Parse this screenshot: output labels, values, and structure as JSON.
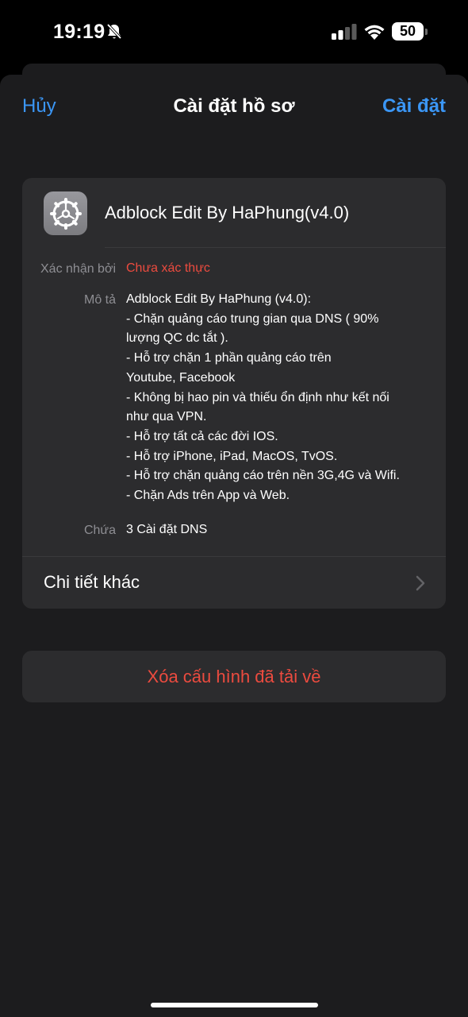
{
  "status_bar": {
    "time": "19:19",
    "battery": "50",
    "icons": [
      "bell-slash-icon",
      "cellular-signal-icon",
      "wifi-icon",
      "battery-icon"
    ]
  },
  "nav": {
    "cancel": "Hủy",
    "title": "Cài đặt hồ sơ",
    "install": "Cài đặt"
  },
  "profile": {
    "icon": "settings-gear-icon",
    "name": "Adblock Edit By HaPhung(v4.0)",
    "verified_by_label": "Xác nhận bởi",
    "verified_by_value": "Chưa xác thực",
    "description_label": "Mô tả",
    "description_lines": [
      "Adblock Edit By HaPhung (v4.0):",
      "- Chặn quảng cáo trung gian qua DNS ( 90%",
      "lượng QC dc tắt ).",
      "- Hỗ trợ chặn 1 phần quảng cáo trên",
      "Youtube, Facebook",
      "- Không bị hao pin và thiếu ổn định như kết nối",
      "như qua VPN.",
      "- Hỗ trợ tất cả các đời IOS.",
      "- Hỗ trợ iPhone, iPad, MacOS, TvOS.",
      "- Hỗ trợ chặn quảng cáo trên nền 3G,4G và Wifi.",
      "- Chặn Ads trên App và Web."
    ],
    "contains_label": "Chứa",
    "contains_value": "3 Cài đặt DNS",
    "more_details": "Chi tiết khác"
  },
  "remove_button": "Xóa cấu hình đã tải về",
  "colors": {
    "accent_blue": "#3b96f5",
    "destructive_red": "#ec4b3f",
    "sheet_bg": "#1c1c1e",
    "card_bg": "#2c2c2e"
  }
}
